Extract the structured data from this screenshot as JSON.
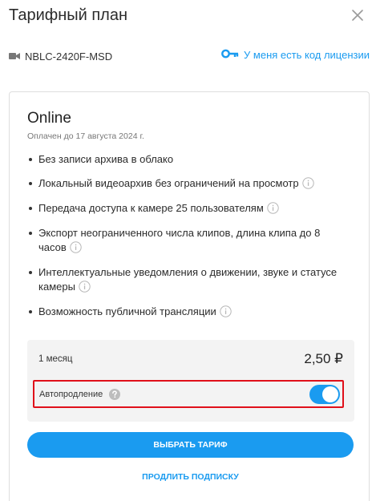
{
  "dialog": {
    "title": "Тарифный план",
    "device_name": "NBLC-2420F-MSD",
    "license_link": "У меня есть код лицензии"
  },
  "plan": {
    "name": "Online",
    "paid_until": "Оплачен до 17 августа 2024 г.",
    "features": [
      "Без записи архива в облако",
      "Локальный видеоархив без ограничений на просмотр",
      "Передача доступа к камере 25 пользователям",
      "Экспорт неограниченного числа клипов, длина клипа до 8 часов",
      "Интеллектуальные уведомления о движении, звуке и статусе камеры",
      "Возможность публичной трансляции"
    ]
  },
  "pricing": {
    "period": "1 месяц",
    "price": "2,50 ₽",
    "autorenew_label": "Автопродление",
    "autorenew_on": true
  },
  "actions": {
    "choose_plan": "ВЫБРАТЬ ТАРИФ",
    "extend_subscription": "ПРОДЛИТЬ ПОДПИСКУ"
  },
  "colors": {
    "accent": "#1a9bf0",
    "highlight_border": "#e0101a"
  },
  "icons": {
    "close": "close-icon",
    "camera": "camera-icon",
    "key": "key-icon",
    "info": "info-icon",
    "help": "question-icon"
  }
}
